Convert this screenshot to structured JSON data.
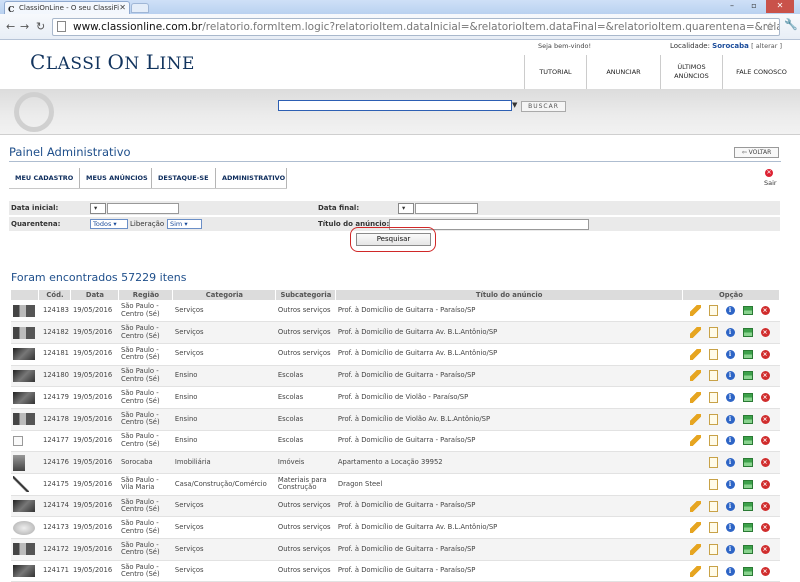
{
  "browser": {
    "tab_title": "ClassiOnLine - O seu ClassiFi",
    "url_host": "www.classionline.com.br",
    "url_path": "/relatorio.formItem.logic?relatorioItem.dataInicial=&relatorioItem.dataFinal=&relatorioItem.quarentena=&relatorioItem.liberacao="
  },
  "header": {
    "logo_part1": "C",
    "logo_part2": "LASSI ",
    "logo_part3": "O",
    "logo_part4": "N ",
    "logo_part5": "L",
    "logo_part6": "INE",
    "welcome": "Seja bem-vindo!",
    "localidade_label": "Localidade:",
    "localidade_city": "Sorocaba",
    "localidade_alterar": "[ alterar ]",
    "nav": [
      "TUTORIAL",
      "ANUNCIAR",
      "ÚLTIMOS ANÚNCIOS",
      "FALE CONOSCO"
    ],
    "search_button": "BUSCAR"
  },
  "panel": {
    "title": "Painel Administrativo",
    "voltar": "VOLTAR",
    "sair": "Sair",
    "tabs": [
      "MEU CADASTRO",
      "MEUS ANÚNCIOS",
      "DESTAQUE-SE",
      "ADMINISTRATIVO"
    ]
  },
  "filters": {
    "data_inicial_label": "Data inicial:",
    "data_final_label": "Data final:",
    "quarentena_label": "Quarentena:",
    "quarentena_value": "Todos",
    "liberacao_label": "Liberação",
    "liberacao_value": "Sim",
    "titulo_label": "Título do anúncio:",
    "pesquisar": "Pesquisar"
  },
  "results": {
    "title": "Foram encontrados 57229 itens",
    "columns": [
      "Cód.",
      "Data",
      "Região",
      "Categoria",
      "Subcategoria",
      "Título do anúncio",
      "Opção"
    ],
    "rows": [
      {
        "thumb": "promo",
        "cod": "124183",
        "data": "19/05/2016",
        "regiao1": "São Paulo -",
        "regiao2": "Centro (Sé)",
        "categoria": "Serviços",
        "sub1": "Outros serviços",
        "sub2": "",
        "titulo": "Prof. à Domicílio de Guitarra - Paraíso/SP",
        "edit": true
      },
      {
        "thumb": "promo",
        "cod": "124182",
        "data": "19/05/2016",
        "regiao1": "São Paulo -",
        "regiao2": "Centro (Sé)",
        "categoria": "Serviços",
        "sub1": "Outros serviços",
        "sub2": "",
        "titulo": "Prof. à Domicílio de Guitarra Av. B.L.Antônio/SP",
        "edit": true
      },
      {
        "thumb": "music",
        "cod": "124181",
        "data": "19/05/2016",
        "regiao1": "São Paulo -",
        "regiao2": "Centro (Sé)",
        "categoria": "Serviços",
        "sub1": "Outros serviços",
        "sub2": "",
        "titulo": "Prof. à Domicílio de Guitarra Av. B.L.Antônio/SP",
        "edit": true
      },
      {
        "thumb": "music",
        "cod": "124180",
        "data": "19/05/2016",
        "regiao1": "São Paulo -",
        "regiao2": "Centro (Sé)",
        "categoria": "Ensino",
        "sub1": "Escolas",
        "sub2": "",
        "titulo": "Prof. à Domicílio de Guitarra - Paraíso/SP",
        "edit": true
      },
      {
        "thumb": "music",
        "cod": "124179",
        "data": "19/05/2016",
        "regiao1": "São Paulo -",
        "regiao2": "Centro (Sé)",
        "categoria": "Ensino",
        "sub1": "Escolas",
        "sub2": "",
        "titulo": "Prof. à Domicílio de Violão - Paraíso/SP",
        "edit": true
      },
      {
        "thumb": "promo",
        "cod": "124178",
        "data": "19/05/2016",
        "regiao1": "São Paulo -",
        "regiao2": "Centro (Sé)",
        "categoria": "Ensino",
        "sub1": "Escolas",
        "sub2": "",
        "titulo": "Prof. à Domicílio de Violão Av. B.L.Antônio/SP",
        "edit": true
      },
      {
        "thumb": "broken",
        "cod": "124177",
        "data": "19/05/2016",
        "regiao1": "São Paulo -",
        "regiao2": "Centro (Sé)",
        "categoria": "Ensino",
        "sub1": "Escolas",
        "sub2": "",
        "titulo": "Prof. à Domicílio de Guitarra - Paraíso/SP",
        "edit": true
      },
      {
        "thumb": "house",
        "cod": "124176",
        "data": "19/05/2016",
        "regiao1": "Sorocaba",
        "regiao2": "",
        "categoria": "Imobiliária",
        "sub1": "Imóveis",
        "sub2": "",
        "titulo": "Apartamento a Locação 39952",
        "edit": false
      },
      {
        "thumb": "sword",
        "cod": "124175",
        "data": "19/05/2016",
        "regiao1": "São Paulo -",
        "regiao2": "Vila Maria",
        "categoria": "Casa/Construção/Comércio",
        "sub1": "Materiais para",
        "sub2": "Construção",
        "titulo": "Dragon Steel",
        "edit": false
      },
      {
        "thumb": "music",
        "cod": "124174",
        "data": "19/05/2016",
        "regiao1": "São Paulo -",
        "regiao2": "Centro (Sé)",
        "categoria": "Serviços",
        "sub1": "Outros serviços",
        "sub2": "",
        "titulo": "Prof. à Domicílio de Guitarra - Paraíso/SP",
        "edit": true
      },
      {
        "thumb": "logo",
        "cod": "124173",
        "data": "19/05/2016",
        "regiao1": "São Paulo -",
        "regiao2": "Centro (Sé)",
        "categoria": "Serviços",
        "sub1": "Outros serviços",
        "sub2": "",
        "titulo": "Prof. à Domicílio de Guitarra Av. B.L.Antônio/SP",
        "edit": true
      },
      {
        "thumb": "promo",
        "cod": "124172",
        "data": "19/05/2016",
        "regiao1": "São Paulo -",
        "regiao2": "Centro (Sé)",
        "categoria": "Serviços",
        "sub1": "Outros serviços",
        "sub2": "",
        "titulo": "Prof. à Domicílio de Guitarra - Paraíso/SP",
        "edit": true
      },
      {
        "thumb": "music",
        "cod": "124171",
        "data": "19/05/2016",
        "regiao1": "São Paulo -",
        "regiao2": "Centro (Sé)",
        "categoria": "Serviços",
        "sub1": "Outros serviços",
        "sub2": "",
        "titulo": "Prof. à Domicílio de Guitarra - Paraíso/SP",
        "edit": true
      }
    ]
  }
}
